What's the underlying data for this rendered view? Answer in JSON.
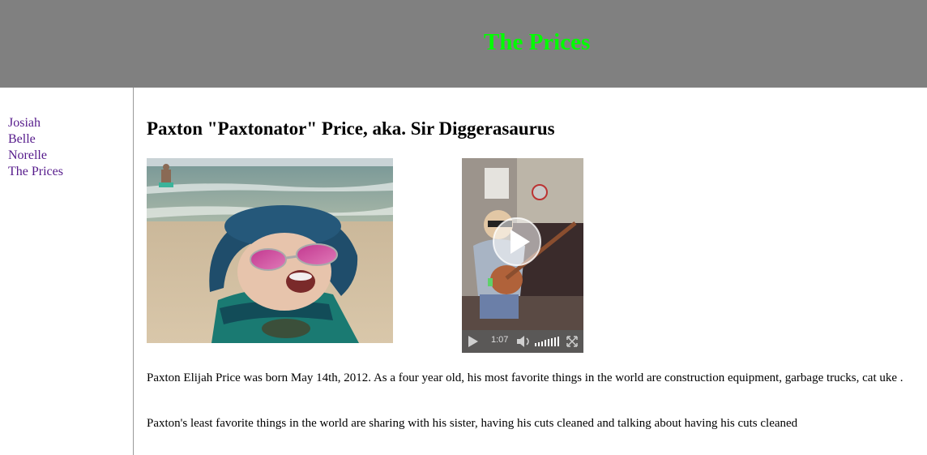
{
  "header": {
    "title": "The Prices",
    "title_color": "#00ff00",
    "background": "#808080"
  },
  "sidebar": {
    "items": [
      {
        "label": "Josiah"
      },
      {
        "label": "Belle"
      },
      {
        "label": "Norelle"
      },
      {
        "label": "The Prices"
      }
    ],
    "link_color": "#551a8b"
  },
  "main": {
    "heading": "Paxton \"Paxtonator\" Price, aka. Sir Diggerasaurus",
    "paragraphs": [
      "Paxton Elijah Price was born May 14th, 2012. As a four year old, his most favorite things in the world are construction equipment, garbage trucks, cat uke .",
      "Paxton's least favorite things in the world are sharing with his sister, having his cuts cleaned and talking about having his cuts cleaned"
    ],
    "video": {
      "time": "1:07"
    }
  }
}
